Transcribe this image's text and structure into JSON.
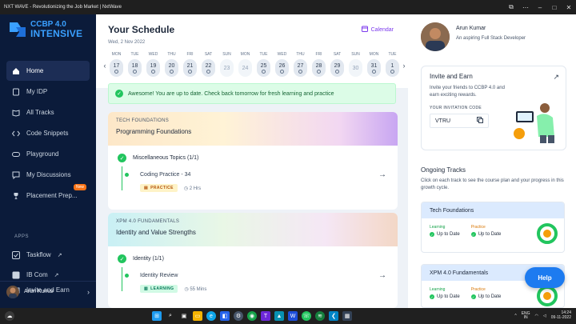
{
  "window": {
    "title": "NXT WAVE - Revolutionizing the Job Market | NxtWave"
  },
  "logo": {
    "line1": "CCBP 4.0",
    "line2": "INTENSIVE"
  },
  "sidebar": {
    "items": [
      {
        "label": "Home",
        "icon": "home-icon"
      },
      {
        "label": "My IDP",
        "icon": "document-icon"
      },
      {
        "label": "All Tracks",
        "icon": "book-icon"
      },
      {
        "label": "Code Snippets",
        "icon": "code-icon"
      },
      {
        "label": "Playground",
        "icon": "controller-icon"
      },
      {
        "label": "My Discussions",
        "icon": "chat-icon"
      },
      {
        "label": "Placement Prep...",
        "icon": "trophy-icon",
        "badge": "New"
      }
    ],
    "apps_label": "APPS",
    "apps": [
      {
        "label": "Taskflow"
      },
      {
        "label": "IB Com"
      },
      {
        "label": "Invite and Earn"
      }
    ],
    "user": "Arun Kumar"
  },
  "schedule": {
    "title": "Your Schedule",
    "date": "Wed, 2 Nov 2022",
    "calendar_label": "Calendar",
    "days": [
      {
        "name": "MON",
        "num": "17"
      },
      {
        "name": "TUE",
        "num": "18"
      },
      {
        "name": "WED",
        "num": "19"
      },
      {
        "name": "THU",
        "num": "20"
      },
      {
        "name": "FRI",
        "num": "21"
      },
      {
        "name": "SAT",
        "num": "22"
      },
      {
        "name": "SUN",
        "num": "23"
      },
      {
        "name": "MON",
        "num": "24"
      },
      {
        "name": "TUE",
        "num": "25"
      },
      {
        "name": "WED",
        "num": "26"
      },
      {
        "name": "THU",
        "num": "27"
      },
      {
        "name": "FRI",
        "num": "28"
      },
      {
        "name": "SAT",
        "num": "29"
      },
      {
        "name": "SUN",
        "num": "30"
      },
      {
        "name": "MON",
        "num": "31"
      },
      {
        "name": "TUE",
        "num": "1"
      }
    ]
  },
  "alert": {
    "text": "Awesome! You are up to date. Check back tomorrow for fresh learning and practice"
  },
  "tracks": [
    {
      "tag": "TECH FOUNDATIONS",
      "name": "Programming Foundations",
      "topic": "Miscellaneous Topics (1/1)",
      "sub": "Coding Practice - 34",
      "pill": "PRACTICE",
      "time": "2 Hrs"
    },
    {
      "tag": "XPM 4.0 FUNDAMENTALS",
      "name": "Identity and Value Strengths",
      "topic": "Identity (1/1)",
      "sub": "Identity Review",
      "pill": "LEARNING",
      "time": "55 Mins"
    }
  ],
  "profile": {
    "name": "Arun Kumar",
    "role": "An aspiring Full Stack Developer"
  },
  "invite": {
    "title": "Invite and Earn",
    "text": "Invite your friends to CCBP 4.0 and earn exciting rewards.",
    "code_label": "YOUR INVITATION CODE",
    "code": "VTRU"
  },
  "ongoing": {
    "title": "Ongoing Tracks",
    "desc": "Click on each track to see the course plan and your progress in this growth cycle.",
    "cards": [
      {
        "name": "Tech Foundations",
        "learning_label": "Learning",
        "learning_val": "Up to Date",
        "practice_label": "Practice",
        "practice_val": "Up to Date"
      },
      {
        "name": "XPM 4.0 Fundamentals",
        "learning_label": "Learning",
        "learning_val": "Up to Date",
        "practice_label": "Practice",
        "practice_val": "Up to Date"
      }
    ]
  },
  "help": "Help",
  "taskbar": {
    "lang1": "ENG",
    "lang2": "IN",
    "time": "14:24",
    "date": "09-11-2022"
  },
  "colors": {
    "sidebar_bg": "#0b1b3a",
    "accent": "#1d7bf0",
    "success": "#22c55e",
    "calendar": "#7c3aed"
  }
}
